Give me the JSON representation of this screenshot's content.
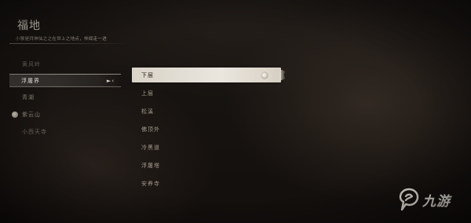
{
  "header": {
    "title": "福地",
    "subtitle": "小猴是拜神仙之之在世上之地点，仲闻走一进"
  },
  "regions": [
    {
      "label": "黄风岭",
      "state": "dim"
    },
    {
      "label": "浮屠界",
      "state": "selected"
    },
    {
      "label": "青湖",
      "state": "normal"
    },
    {
      "label": "紫云山",
      "state": "normal"
    },
    {
      "label": "小西天寺",
      "state": "dim"
    }
  ],
  "locations": [
    {
      "label": "下层",
      "state": "selected"
    },
    {
      "label": "上层",
      "state": "normal"
    },
    {
      "label": "松溪",
      "state": "normal"
    },
    {
      "label": "佛顶外",
      "state": "normal"
    },
    {
      "label": "冷黑道",
      "state": "normal"
    },
    {
      "label": "浮屠塔",
      "state": "normal"
    },
    {
      "label": "安养寺",
      "state": "normal"
    }
  ],
  "icons": {
    "region_cursor": "chevron-right-icon",
    "region_bullet": "orb-icon",
    "location_marker": "shrine-marker-icon"
  },
  "watermark": {
    "text": "九游"
  },
  "colors": {
    "accent": "#e6dfd2",
    "selected_bg": "#eae6de",
    "text_dim": "#8c8578"
  }
}
